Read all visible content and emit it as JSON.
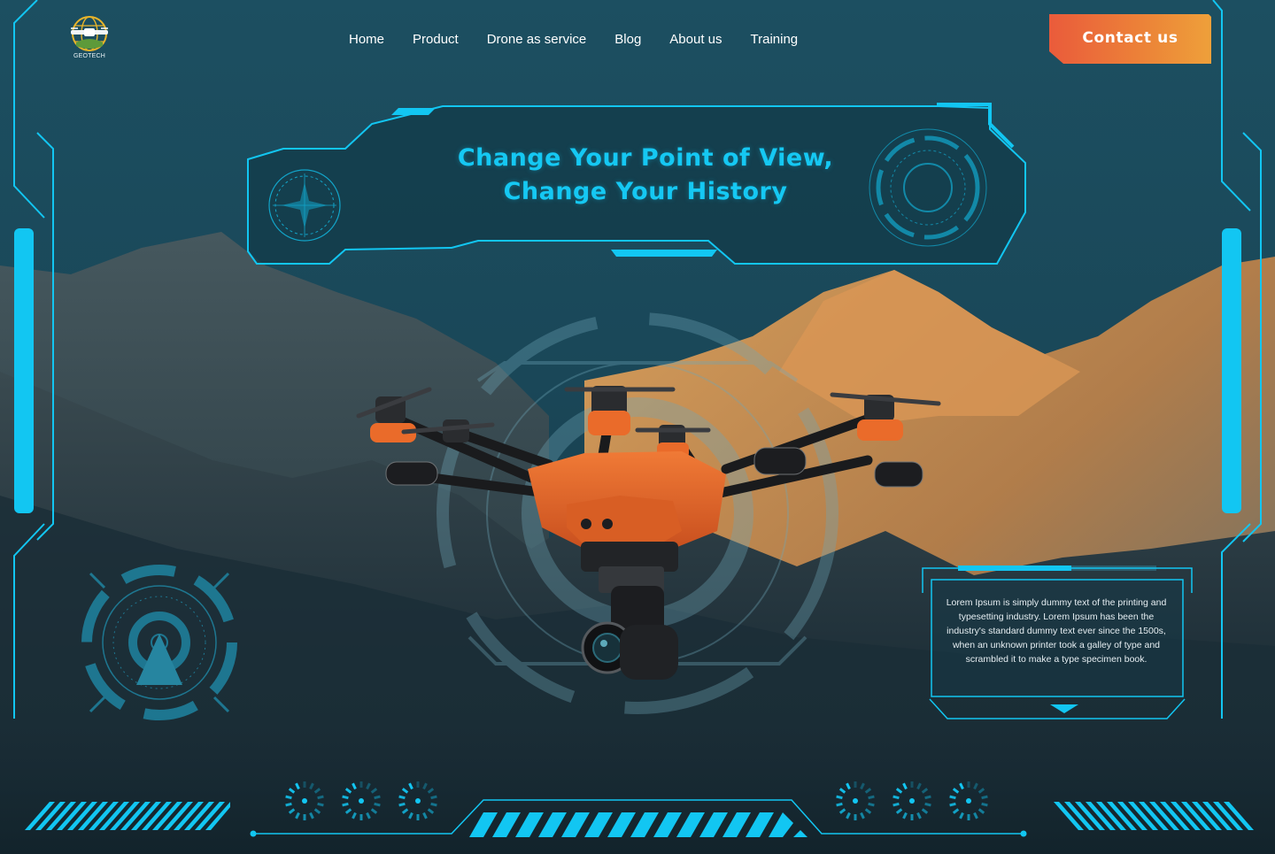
{
  "brand": {
    "name": "GEOTECH"
  },
  "nav": {
    "items": [
      {
        "label": "Home"
      },
      {
        "label": "Product"
      },
      {
        "label": "Drone as service"
      },
      {
        "label": "Blog"
      },
      {
        "label": "About us"
      },
      {
        "label": "Training"
      }
    ]
  },
  "cta": {
    "label": "Contact us"
  },
  "hero": {
    "title_line1": "Change Your Point of View,",
    "title_line2": "Change Your History"
  },
  "info_panel": {
    "text": "Lorem Ipsum is simply dummy text of the printing and typesetting industry. Lorem Ipsum has been the industry's standard dummy text ever since the 1500s, when an unknown printer took a galley of type and scrambled it to make a type specimen book."
  },
  "colors": {
    "accent_cyan": "#12c6f2",
    "cta_gradient_start": "#ea5b3b",
    "cta_gradient_end": "#eea03a",
    "drone_orange": "#e8662a",
    "background_teal": "#17404f"
  },
  "icons": [
    "globe-logo-icon",
    "compass-icon",
    "target-ring-icon",
    "radar-triangle-icon",
    "loading-dial-icon",
    "scroll-down-arrow-icon"
  ]
}
